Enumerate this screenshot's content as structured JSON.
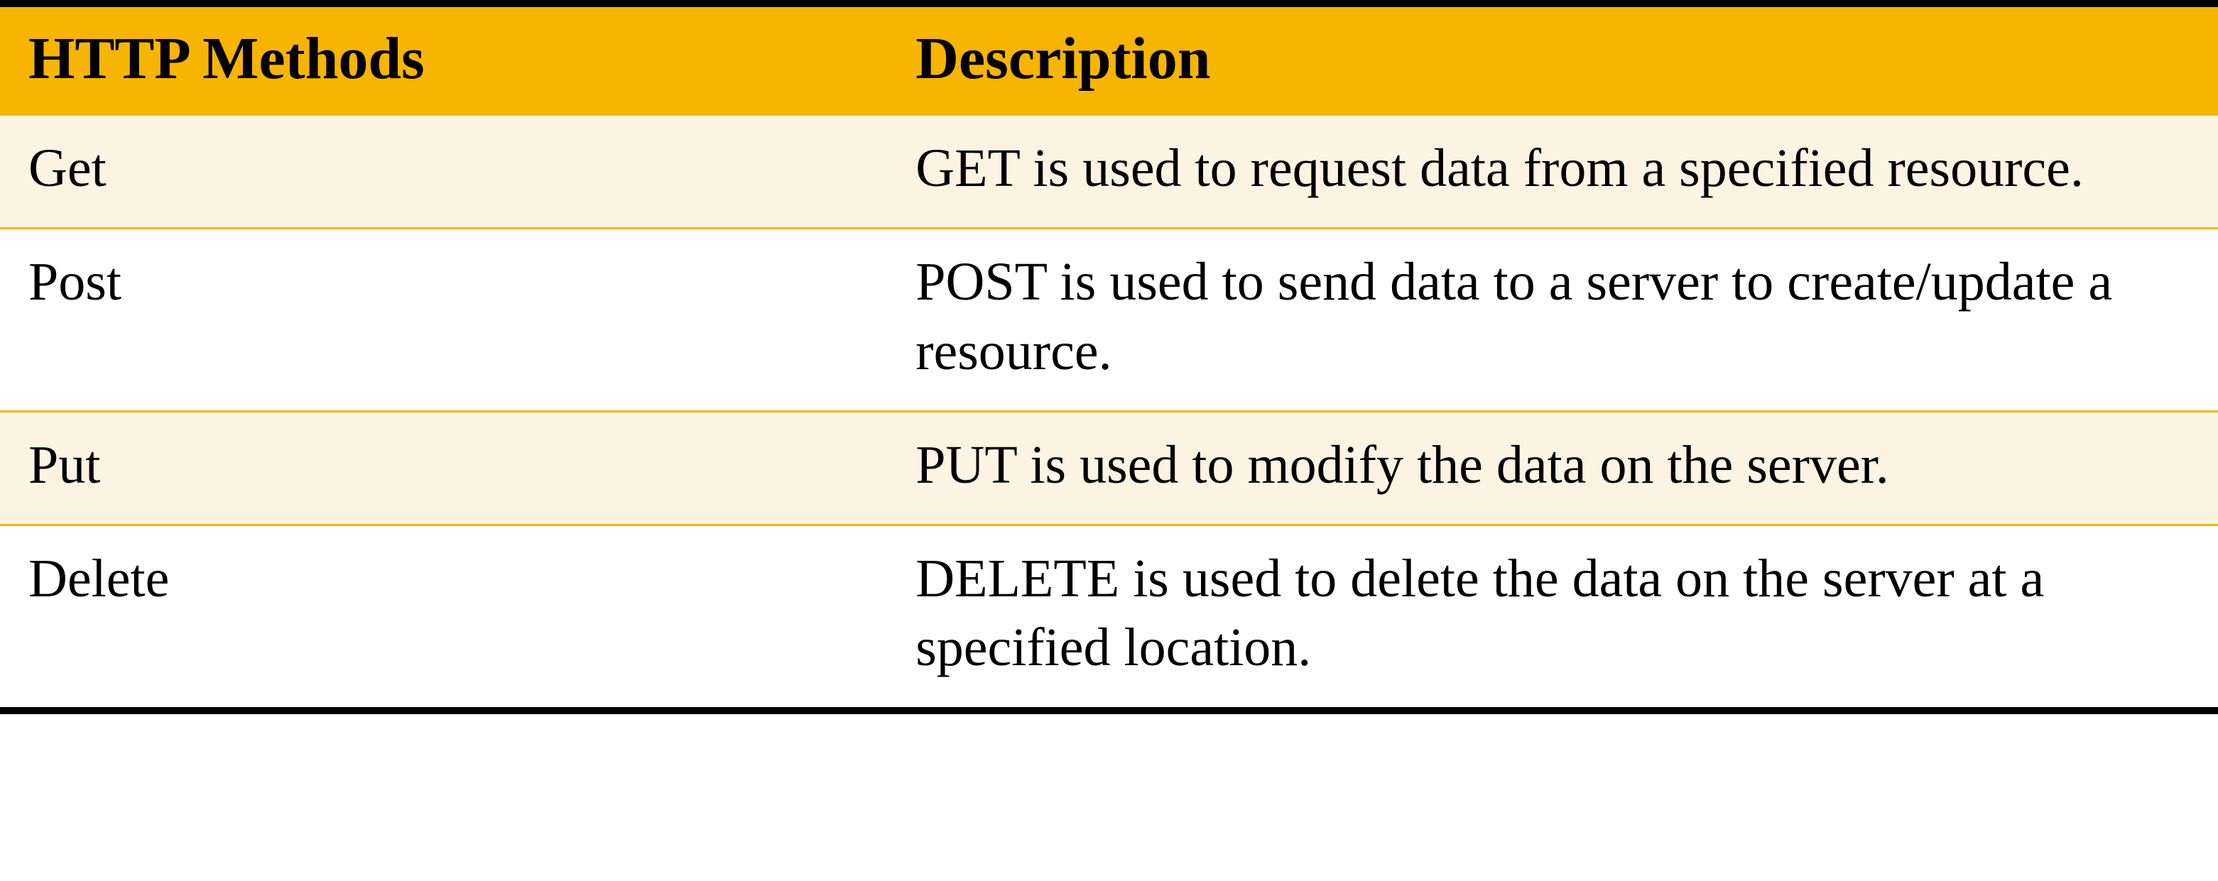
{
  "table": {
    "headers": {
      "methods": "HTTP Methods",
      "description": "Description"
    },
    "rows": [
      {
        "method": "Get",
        "description": "GET is used to request data from a specified resource."
      },
      {
        "method": "Post",
        "description": "POST is used to send data to a server to create/update a resource."
      },
      {
        "method": "Put",
        "description": "PUT is used to modify the data on the server."
      },
      {
        "method": "Delete",
        "description": "DELETE is used to delete the data on the server at a specified location."
      }
    ]
  }
}
